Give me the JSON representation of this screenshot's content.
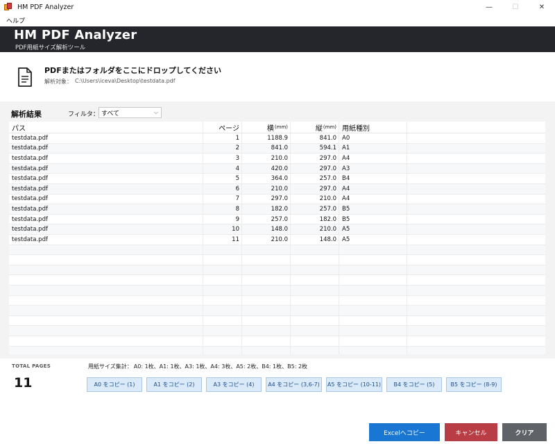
{
  "window": {
    "title": "HM PDF Analyzer",
    "minimize_glyph": "—",
    "maximize_glyph": "☐",
    "close_glyph": "✕"
  },
  "menu": {
    "help": "ヘルプ"
  },
  "header": {
    "title": "HM PDF Analyzer",
    "subtitle": "PDF用紙サイズ解析ツール"
  },
  "drop_zone": {
    "icon": "document-icon",
    "title": "PDFまたはフォルダをここにドロップしてください",
    "target_label": "解析対象：",
    "target_path": "C:\\Users\\iceva\\Desktop\\testdata.pdf"
  },
  "results": {
    "label": "解析結果",
    "filter_label": "フィルタ：",
    "filter_value": "すべて",
    "columns": {
      "path": "パス",
      "page": "ページ",
      "width": "横",
      "width_unit": "(mm)",
      "height": "縦",
      "height_unit": "(mm)",
      "size": "用紙種別"
    },
    "rows": [
      {
        "path": "testdata.pdf",
        "page": "1",
        "width": "1188.9",
        "height": "841.0",
        "size": "A0"
      },
      {
        "path": "testdata.pdf",
        "page": "2",
        "width": "841.0",
        "height": "594.1",
        "size": "A1"
      },
      {
        "path": "testdata.pdf",
        "page": "3",
        "width": "210.0",
        "height": "297.0",
        "size": "A4"
      },
      {
        "path": "testdata.pdf",
        "page": "4",
        "width": "420.0",
        "height": "297.0",
        "size": "A3"
      },
      {
        "path": "testdata.pdf",
        "page": "5",
        "width": "364.0",
        "height": "257.0",
        "size": "B4"
      },
      {
        "path": "testdata.pdf",
        "page": "6",
        "width": "210.0",
        "height": "297.0",
        "size": "A4"
      },
      {
        "path": "testdata.pdf",
        "page": "7",
        "width": "297.0",
        "height": "210.0",
        "size": "A4"
      },
      {
        "path": "testdata.pdf",
        "page": "8",
        "width": "182.0",
        "height": "257.0",
        "size": "B5"
      },
      {
        "path": "testdata.pdf",
        "page": "9",
        "width": "257.0",
        "height": "182.0",
        "size": "B5"
      },
      {
        "path": "testdata.pdf",
        "page": "10",
        "width": "148.0",
        "height": "210.0",
        "size": "A5"
      },
      {
        "path": "testdata.pdf",
        "page": "11",
        "width": "210.0",
        "height": "148.0",
        "size": "A5"
      }
    ],
    "empty_rows": 11
  },
  "footer": {
    "total_label": "TOTAL PAGES",
    "total_value": "11",
    "summary_label": "用紙サイズ集計：",
    "summary_text": "A0: 1枚、A1: 1枚、A3: 1枚、A4: 3枚、A5: 2枚、B4: 1枚、B5: 2枚",
    "copy_buttons": [
      "A0 をコピー (1)",
      "A1 をコピー (2)",
      "A3 をコピー (4)",
      "A4 をコピー (3,6-7)",
      "A5 をコピー (10-11)",
      "B4 をコピー (5)",
      "B5 をコピー (8-9)"
    ],
    "excel_button": "Excelへコピー",
    "cancel_button": "キャンセル",
    "clear_button": "クリア"
  }
}
